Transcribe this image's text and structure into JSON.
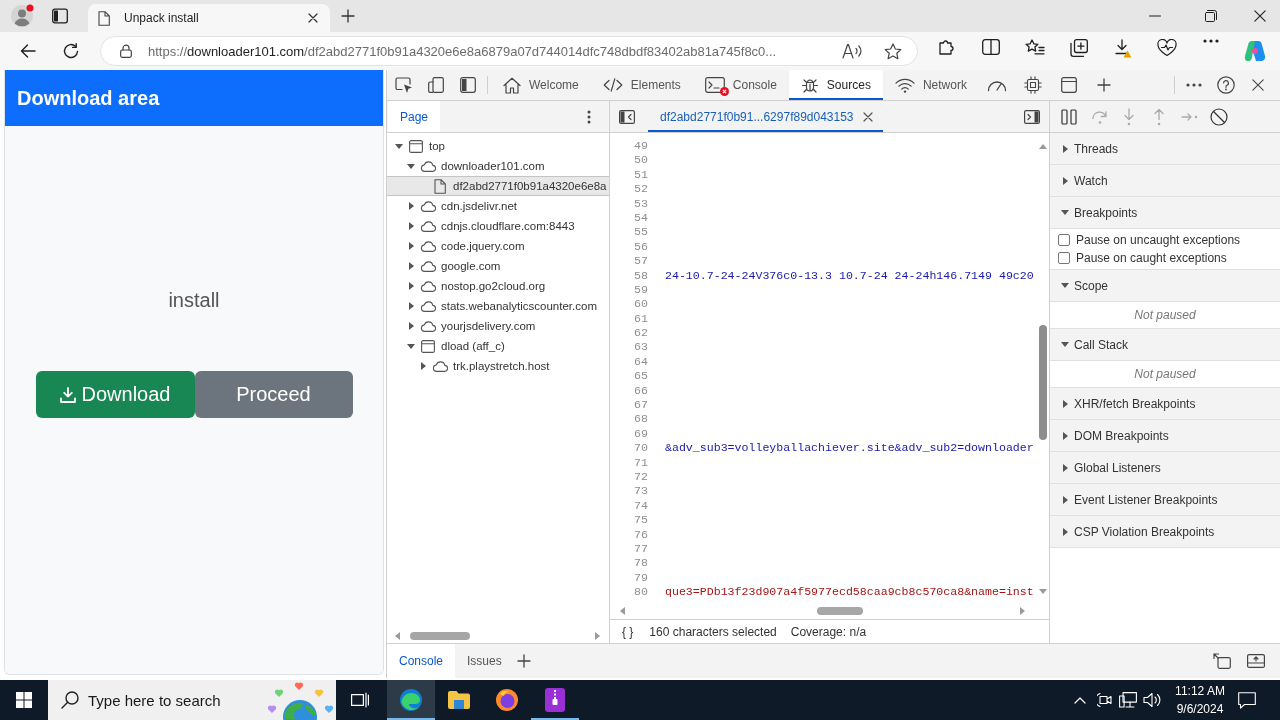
{
  "browser": {
    "tabs": [
      {
        "title": "Unpack install",
        "selected": true
      }
    ],
    "address": {
      "scheme": "https://",
      "host": "downloader101.com",
      "path": "/df2abd2771f0b91a4320e6e8a6879a07d744014dfc748dbdf83402ab81a745f8c0..."
    }
  },
  "page": {
    "header": "Download area",
    "message": "install",
    "buttons": [
      {
        "label": "Download",
        "kind": "primary"
      },
      {
        "label": "Proceed",
        "kind": "secondary"
      }
    ]
  },
  "devtools": {
    "tabs": [
      {
        "kind": "welcome",
        "label": "Welcome",
        "selected": false,
        "error": false
      },
      {
        "kind": "elements",
        "label": "Elements",
        "selected": false,
        "error": false
      },
      {
        "kind": "console",
        "label": "Console",
        "selected": false,
        "error": true
      },
      {
        "kind": "sources",
        "label": "Sources",
        "selected": true,
        "error": false
      },
      {
        "kind": "network",
        "label": "Network",
        "selected": false,
        "error": false
      },
      {
        "kind": "performance",
        "selected": false,
        "error": false
      },
      {
        "kind": "memory",
        "selected": false,
        "error": false
      },
      {
        "kind": "application",
        "selected": false,
        "error": false
      }
    ],
    "navigator": {
      "tabs": [
        {
          "label": "Page",
          "selected": true
        }
      ],
      "tree": [
        {
          "label": "top",
          "kind": "frame",
          "expanded": true,
          "selected": false,
          "children": [
            {
              "label": "downloader101.com",
              "kind": "domain",
              "expanded": true,
              "selected": false,
              "children": [
                {
                  "label": "df2abd2771f0b91a4320e6e8a",
                  "kind": "file",
                  "selected": true
                }
              ]
            },
            {
              "label": "cdn.jsdelivr.net",
              "kind": "domain",
              "expanded": false,
              "selected": false
            },
            {
              "label": "cdnjs.cloudflare.com:8443",
              "kind": "domain",
              "expanded": false,
              "selected": false
            },
            {
              "label": "code.jquery.com",
              "kind": "domain",
              "expanded": false,
              "selected": false
            },
            {
              "label": "google.com",
              "kind": "domain",
              "expanded": false,
              "selected": false
            },
            {
              "label": "nostop.go2cloud.org",
              "kind": "domain",
              "expanded": false,
              "selected": false
            },
            {
              "label": "stats.webanalyticscounter.com",
              "kind": "domain",
              "expanded": false,
              "selected": false
            },
            {
              "label": "yourjsdelivery.com",
              "kind": "domain",
              "expanded": false,
              "selected": false
            },
            {
              "label": "dload (aff_c)",
              "kind": "frame",
              "expanded": true,
              "selected": false,
              "children": [
                {
                  "label": "trk.playstretch.host",
                  "kind": "domain",
                  "expanded": false,
                  "selected": false
                }
              ]
            }
          ]
        }
      ]
    },
    "editor": {
      "tabs": [
        {
          "label": "df2abd2771f0b91...6297f89d043153",
          "selected": true
        }
      ],
      "lines": [
        {
          "number": "49",
          "kind": "blank"
        },
        {
          "number": "50",
          "kind": "blank"
        },
        {
          "number": "51",
          "kind": "blank"
        },
        {
          "number": "52",
          "kind": "blank"
        },
        {
          "number": "53",
          "kind": "blank"
        },
        {
          "number": "54",
          "kind": "blank"
        },
        {
          "number": "55",
          "kind": "blank"
        },
        {
          "number": "56",
          "kind": "blank"
        },
        {
          "number": "57",
          "kind": "blank"
        },
        {
          "number": "58",
          "kind": "attribute-value",
          "text": "24-10.7-24-24V376c0-13.3 10.7-24 24-24h146.7149 49c20"
        },
        {
          "number": "59",
          "kind": "blank"
        },
        {
          "number": "60",
          "kind": "blank"
        },
        {
          "number": "61",
          "kind": "blank"
        },
        {
          "number": "62",
          "kind": "blank"
        },
        {
          "number": "63",
          "kind": "blank"
        },
        {
          "number": "64",
          "kind": "blank"
        },
        {
          "number": "65",
          "kind": "blank"
        },
        {
          "number": "66",
          "kind": "blank"
        },
        {
          "number": "67",
          "kind": "blank"
        },
        {
          "number": "68",
          "kind": "blank"
        },
        {
          "number": "69",
          "kind": "blank"
        },
        {
          "number": "70",
          "kind": "attribute-value",
          "text": "&adv_sub3=volleyballachiever.site&adv_sub2=downloader"
        },
        {
          "number": "71",
          "kind": "blank"
        },
        {
          "number": "72",
          "kind": "blank"
        },
        {
          "number": "73",
          "kind": "blank"
        },
        {
          "number": "74",
          "kind": "blank"
        },
        {
          "number": "75",
          "kind": "blank"
        },
        {
          "number": "76",
          "kind": "blank"
        },
        {
          "number": "77",
          "kind": "blank"
        },
        {
          "number": "78",
          "kind": "blank"
        },
        {
          "number": "79",
          "kind": "blank"
        },
        {
          "number": "80",
          "kind": "string",
          "text": "que3=PDb13f23d907a4f5977ecd58caa9cb8c570ca8&name=inst"
        }
      ],
      "status": {
        "format": "{ }",
        "selection": "160 characters selected",
        "coverage": "Coverage: n/a"
      }
    },
    "debugger": {
      "sections": [
        {
          "title": "Threads",
          "expanded": false
        },
        {
          "title": "Watch",
          "expanded": false
        },
        {
          "title": "Breakpoints",
          "expanded": true,
          "options": [
            {
              "label": "Pause on uncaught exceptions",
              "checked": false
            },
            {
              "label": "Pause on caught exceptions",
              "checked": false
            }
          ]
        },
        {
          "title": "Scope",
          "expanded": true,
          "message": "Not paused"
        },
        {
          "title": "Call Stack",
          "expanded": true,
          "message": "Not paused"
        },
        {
          "title": "XHR/fetch Breakpoints",
          "expanded": false
        },
        {
          "title": "DOM Breakpoints",
          "expanded": false
        },
        {
          "title": "Global Listeners",
          "expanded": false
        },
        {
          "title": "Event Listener Breakpoints",
          "expanded": false
        },
        {
          "title": "CSP Violation Breakpoints",
          "expanded": false
        }
      ]
    },
    "drawer": {
      "tabs": [
        {
          "label": "Console",
          "selected": true
        },
        {
          "label": "Issues",
          "selected": false
        }
      ]
    }
  },
  "taskbar": {
    "search": {
      "placeholder": "Type here to search"
    },
    "apps": [
      {
        "kind": "edge",
        "selected": true,
        "running": true
      },
      {
        "kind": "files",
        "selected": false,
        "running": false
      },
      {
        "kind": "firefox",
        "selected": false,
        "running": false
      },
      {
        "kind": "archiver",
        "selected": false,
        "running": true
      }
    ],
    "time": "11:12 AM",
    "date": "9/6/2024"
  }
}
